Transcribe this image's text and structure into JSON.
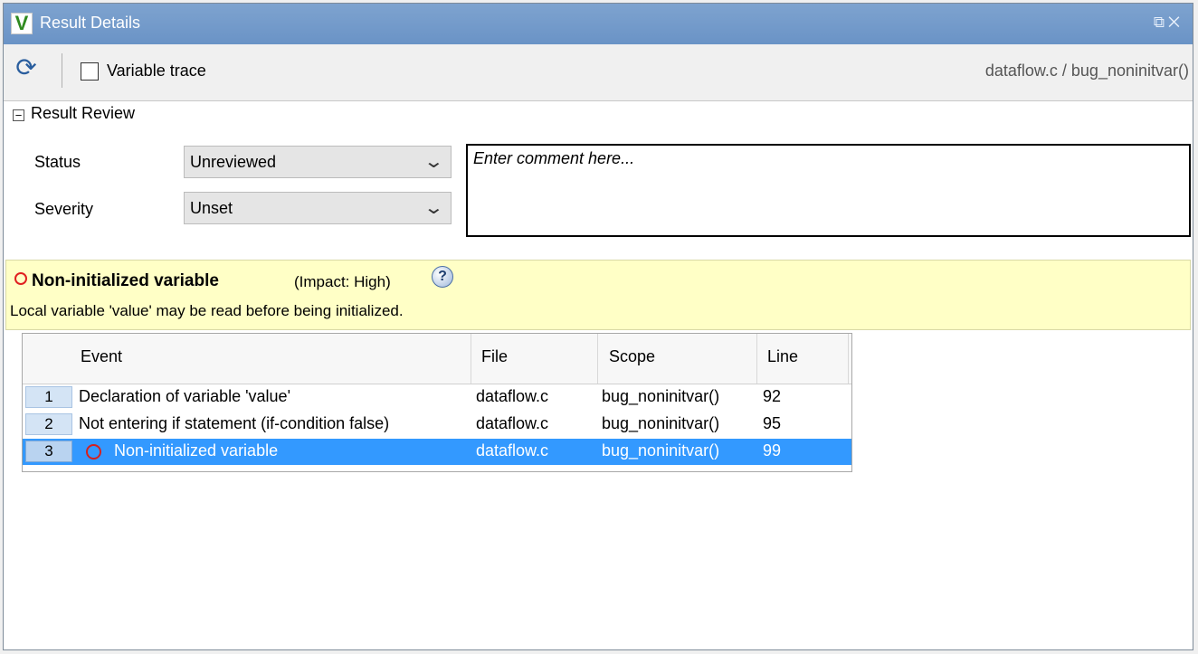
{
  "window": {
    "title": "Result Details",
    "controls": "⧉✕"
  },
  "toolbar": {
    "refresh_icon": "refresh-icon",
    "variable_trace_label": "Variable trace",
    "variable_trace_checked": false,
    "path": "dataflow.c / bug_noninitvar()"
  },
  "review": {
    "section_title": "Result Review",
    "toggle_symbol": "−",
    "status_label": "Status",
    "status_value": "Unreviewed",
    "severity_label": "Severity",
    "severity_value": "Unset",
    "comment_placeholder": "Enter comment here..."
  },
  "defect": {
    "title": "Non-initialized variable",
    "impact": "(Impact: High)",
    "help_symbol": "?",
    "description": "Local variable 'value' may be read before being initialized.",
    "circle_color": "#e02020"
  },
  "events": {
    "columns": [
      "Event",
      "File",
      "Scope",
      "Line"
    ],
    "rows": [
      {
        "num": "1",
        "event": "Declaration of variable 'value'",
        "file": "dataflow.c",
        "scope": "bug_noninitvar()",
        "line": "92"
      },
      {
        "num": "2",
        "event": "Not entering if statement (if-condition false)",
        "file": "dataflow.c",
        "scope": "bug_noninitvar()",
        "line": "95"
      },
      {
        "num": "3",
        "event": "Non-initialized variable",
        "file": "dataflow.c",
        "scope": "bug_noninitvar()",
        "line": "99",
        "selected": true
      }
    ]
  },
  "colors": {
    "titlebar": "#6a93c6",
    "selection": "#3399ff",
    "defect_banner": "#ffffc6"
  }
}
